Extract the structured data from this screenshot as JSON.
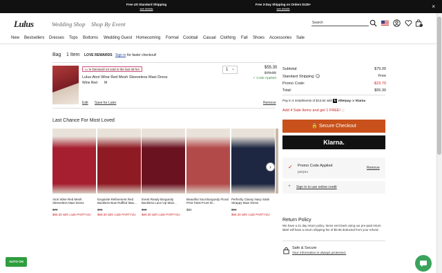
{
  "promo_bar": {
    "left_title": "Free US Standard Shipping",
    "left_link": "see details",
    "right_title": "Free 3-Day Shipping on Orders $125+",
    "right_link": "see details",
    "close": "×"
  },
  "header": {
    "logo": "Lulus",
    "tabs": [
      "Wedding Shop",
      "Shop By Event"
    ],
    "search_placeholder": "Search",
    "cart_count": "1"
  },
  "nav": [
    "New",
    "Bestsellers",
    "Dresses",
    "Tops",
    "Bottoms",
    "Wedding Guest",
    "Homecoming",
    "Formal",
    "Cocktail",
    "Casual",
    "Clothing",
    "Fall",
    "Shoes",
    "Accessories",
    "Sale"
  ],
  "bag": {
    "title": "Bag",
    "count": "1 Item",
    "rewards": "LOVE REWARDS",
    "sign_in": "Sign in",
    "sign_in_suffix": "for faster checkout!",
    "item": {
      "badge": "In Demand! 24 sold in the last 48 hrs",
      "name": "Lulus Atori Wine Red Mesh Sleeveless Maxi Dress",
      "color": "Wine Red",
      "size": "M",
      "qty": "1",
      "price": "$55.30",
      "old_price": "$79.00",
      "code_applied": "Code Applied",
      "edit": "Edit",
      "save_later": "Save for Later",
      "remove": "Remove"
    }
  },
  "last_chance": {
    "title": "Last Chance For Most Loved",
    "products": [
      {
        "name": "Atori Wine Red Mesh Sleeveless Maxi Dress",
        "old": "$79",
        "price": "$55.30",
        "code": "with code PARTY4U",
        "color": "#a51f30"
      },
      {
        "name": "Exquisite Refinement Red Backless Bow Ruffled Max...",
        "old": "$99",
        "price": "$69.30",
        "code": "with code PARTY4U",
        "color": "#8e1b24"
      },
      {
        "name": "Event Ready Burgundy Backless Lace-Up Maxi...",
        "old": "$99",
        "price": "$69.30",
        "code": "with code PARTY4U",
        "color": "#6a1220"
      },
      {
        "name": "Beautiful Soul Burgundy Floral Print Twist-Front M...",
        "old": "",
        "price": "$92",
        "code": "",
        "color": "#b34a4a"
      },
      {
        "name": "Perfectly Classy Navy Satin Strappy Maxi Dress",
        "old": "$99",
        "price": "$69.30",
        "code": "with code PARTY4U",
        "color": "#1d2742"
      }
    ]
  },
  "summary": {
    "subtotal_label": "Subtotal:",
    "subtotal": "$79.00",
    "shipping_label": "Standard Shipping:",
    "shipping": "Free",
    "promo_label": "Promo Code:",
    "promo": "-$23.70",
    "total_label": "Total:",
    "total": "$55.30",
    "installments": "Pay in 4 installments of $13.82 with",
    "afterpay": "Afterpay",
    "or": "or",
    "klarna_small": "Klarna",
    "sale_offer": "Add 4 Sale Items and get 1 FREE!",
    "checkout": "Secure Checkout",
    "klarna_button": "Klarna.",
    "promo_applied": "Promo Code Applied",
    "promo_code": "party4u",
    "promo_remove": "Remove",
    "credit": "Sign in to use online credit"
  },
  "return_policy": {
    "title": "Return Policy",
    "text": "We have a 21 day return policy. Items sent back using our pre-paid return label will have a return shipping fee of $5.95 deducted from your refund."
  },
  "safe": {
    "title": "Safe & Secure",
    "text": "Your information is always protected."
  },
  "auto_on": "AUTO ON",
  "colors": {
    "checkout": "#c8511b",
    "sale_red": "#c22222",
    "green": "#2e9e3e"
  }
}
